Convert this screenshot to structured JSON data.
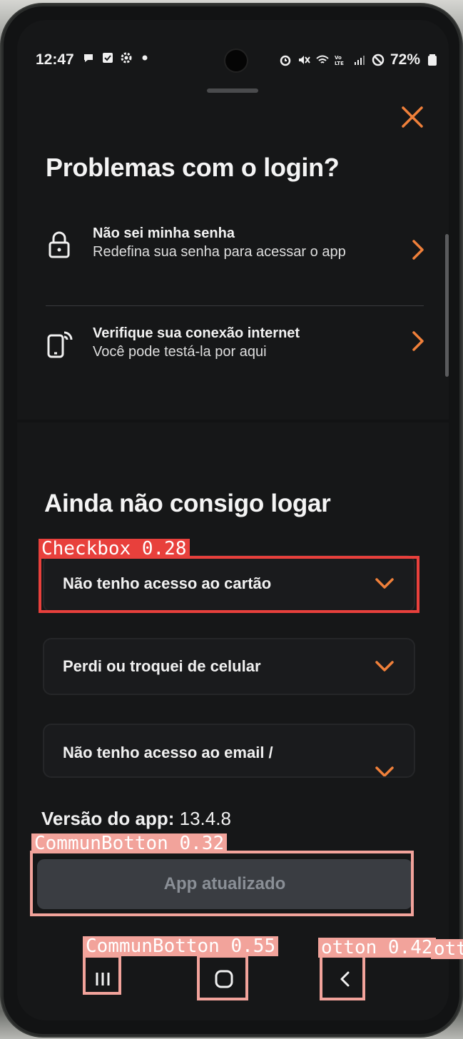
{
  "status_bar": {
    "time": "12:47",
    "battery": "72%",
    "left_icons": [
      "chat-bubble-icon",
      "checkbox-notify-icon",
      "settings-gear-icon",
      "dot-icon"
    ],
    "right_icons": [
      "alarm-icon",
      "mute-icon",
      "wifi-icon",
      "volte-icon",
      "signal-icon",
      "dnd-icon",
      "battery-icon"
    ]
  },
  "header": {
    "title": "Problemas com o login?"
  },
  "options": [
    {
      "title": "Não sei minha senha",
      "subtitle": "Redefina sua senha para acessar o app",
      "icon": "lock-icon"
    },
    {
      "title": "Verifique sua conexão internet",
      "subtitle": "Você pode testá-la por aqui",
      "icon": "phone-signal-icon"
    }
  ],
  "section": {
    "title": "Ainda não consigo logar"
  },
  "accordions": [
    {
      "label": "Não tenho acesso ao cartão"
    },
    {
      "label": "Perdi ou troquei de celular"
    },
    {
      "label": "Não tenho acesso ao email /"
    }
  ],
  "version": {
    "label": "Versão do app:",
    "value": "13.4.8"
  },
  "update_button": {
    "label": "App atualizado"
  },
  "detections": [
    {
      "label": "Checkbox  0.28"
    },
    {
      "label": "CommunBotton  0.32"
    },
    {
      "label": "CommunBotton  0.55"
    },
    {
      "label": "otton  0.42"
    },
    {
      "label": "ott"
    }
  ],
  "colors": {
    "accent": "#f0803a",
    "background": "#161718",
    "button_bg": "#3a3d42",
    "detection_red": "#e8403c",
    "detection_pink": "#f2a39b"
  }
}
